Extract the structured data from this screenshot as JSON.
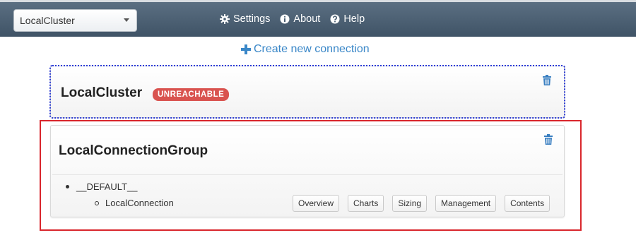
{
  "header": {
    "cluster_select_value": "LocalCluster",
    "links": [
      {
        "label": "Settings",
        "icon": "gear-icon"
      },
      {
        "label": "About",
        "icon": "info-icon"
      },
      {
        "label": "Help",
        "icon": "help-icon"
      }
    ]
  },
  "create_connection_label": "Create new connection",
  "clusters": [
    {
      "title": "LocalCluster",
      "status_badge": "UNREACHABLE"
    },
    {
      "title": "LocalConnectionGroup",
      "group": "__DEFAULT__",
      "connection": "LocalConnection",
      "actions": [
        "Overview",
        "Charts",
        "Sizing",
        "Management",
        "Contents"
      ]
    }
  ],
  "colors": {
    "navbar": "#4d6174",
    "link": "#3a87c8",
    "badge": "#d9534f",
    "highlight": "#d9262c",
    "focus_outline": "#2b3bd6"
  }
}
